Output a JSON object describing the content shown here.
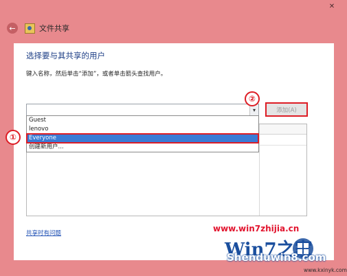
{
  "window": {
    "title": "文件共享",
    "close_glyph": "✕",
    "back_glyph": "←"
  },
  "dialog": {
    "heading": "选择要与其共享的用户",
    "instruction": "键入名称，然后单击“添加”，或者单击箭头查找用户。",
    "combo_value": "",
    "combo_arrow_glyph": "▾",
    "add_button_label": "添加(A)",
    "dropdown_items": [
      "Guest",
      "lenovo",
      "Everyone",
      "创建新用户..."
    ],
    "selected_item": "Everyone",
    "help_link": "共享时有问题"
  },
  "annotations": {
    "marker_1": "①",
    "marker_2": "②"
  },
  "watermark": {
    "url": "www.win7zhijia.cn",
    "logo_text": "Win7之家",
    "site_text": "Shenduwin8.com",
    "site_url": "www.kxinyk.com"
  },
  "colors": {
    "window_accent": "#e8898d",
    "highlight": "#3a7bd5",
    "annotation_red": "#dd1c24",
    "link_blue": "#1f50b4"
  }
}
